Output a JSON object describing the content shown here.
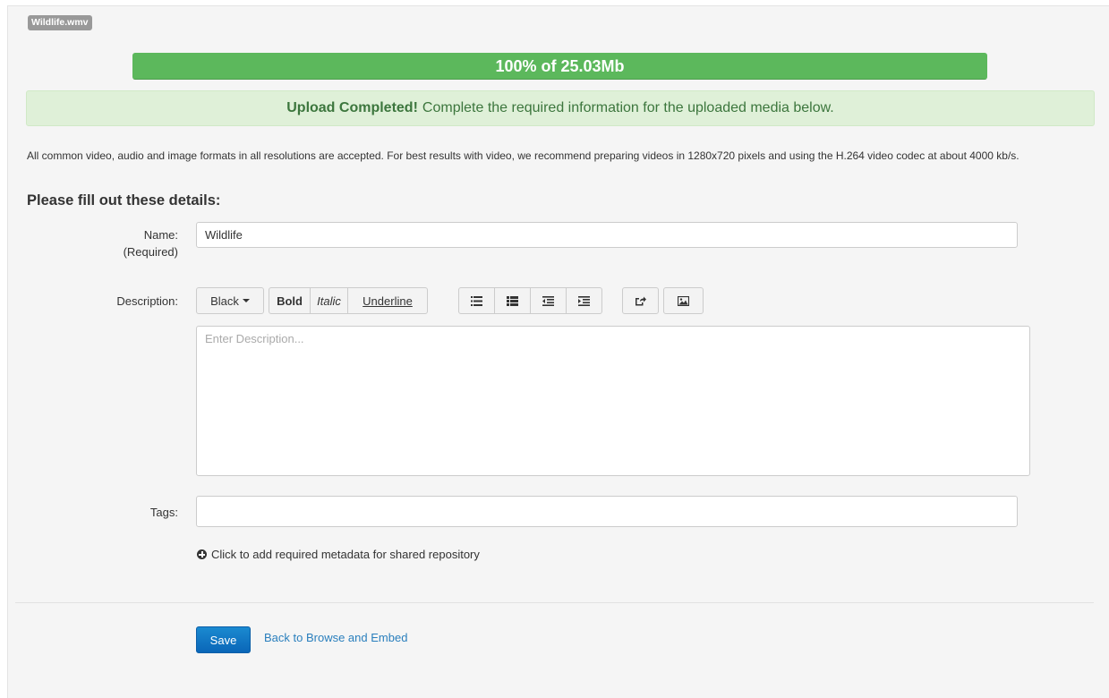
{
  "file": {
    "name": "Wildlife.wmv"
  },
  "progress": {
    "text": "100% of 25.03Mb",
    "percent": 100
  },
  "alert": {
    "strong": "Upload Completed!",
    "message": "Complete the required information for the uploaded media below."
  },
  "info_text": "All common video, audio and image formats in all resolutions are accepted.  For best results with video, we recommend preparing videos in 1280x720 pixels and using the H.264 video codec at about 4000 kb/s.",
  "heading": "Please fill out these details:",
  "form": {
    "name_label": "Name:",
    "name_required": "(Required)",
    "name_value": "Wildlife",
    "description_label": "Description:",
    "description_placeholder": "Enter Description...",
    "tags_label": "Tags:",
    "tags_value": ""
  },
  "toolbar": {
    "color": "Black",
    "bold": "Bold",
    "italic": "Italic",
    "underline": "Underline",
    "icons": [
      "unordered-list-icon",
      "ordered-list-icon",
      "outdent-icon",
      "indent-icon",
      "link-icon",
      "image-icon"
    ]
  },
  "metadata_link": "Click to add required metadata for shared repository",
  "actions": {
    "save": "Save",
    "back": "Back to Browse and Embed"
  },
  "colors": {
    "progress": "#5cb85c",
    "alert_bg": "#dff0d8",
    "alert_text": "#3c763d",
    "primary": "#0a66b8",
    "link": "#2a7fbd"
  }
}
